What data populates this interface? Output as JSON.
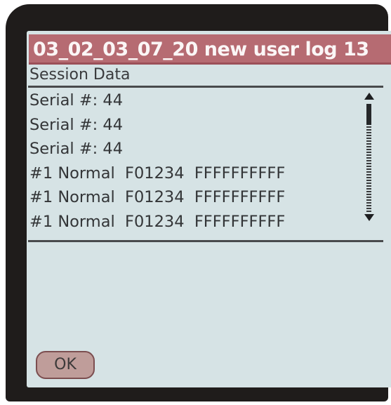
{
  "title_bar": {
    "title": "03_02_03_07_20 new user log 13"
  },
  "section_label": "Session Data",
  "rows": [
    "Serial #: 44",
    "Serial #: 44",
    "Serial #: 44",
    "#1 Normal  F01234  FFFFFFFFFF",
    "#1 Normal  F01234  FFFFFFFFFF",
    "#1 Normal  F01234  FFFFFFFFFF"
  ],
  "buttons": {
    "ok_label": "OK"
  },
  "icons": {
    "scroll_up": "scroll-up-arrow-icon",
    "scroll_down": "scroll-down-arrow-icon"
  },
  "colors": {
    "title_bar": "#b66b72",
    "screen_background": "#d6e3e5",
    "ok_button": "#bf9d9a"
  }
}
